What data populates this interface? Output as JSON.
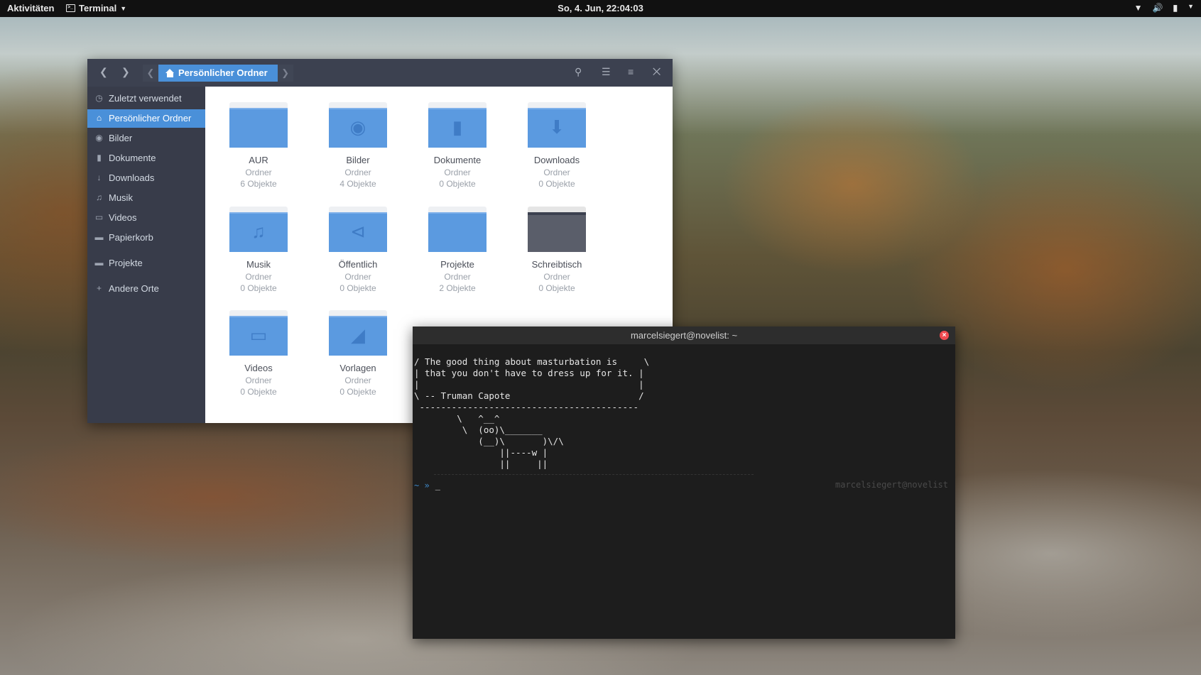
{
  "topbar": {
    "activities": "Aktivitäten",
    "app_name": "Terminal",
    "clock": "So,  4. Jun, 22:04:03"
  },
  "file_manager": {
    "path_current": "Persönlicher Ordner",
    "sidebar": [
      {
        "label": "Zuletzt verwendet",
        "icon": "clock-icon"
      },
      {
        "label": "Persönlicher Ordner",
        "icon": "home-icon",
        "active": true
      },
      {
        "label": "Bilder",
        "icon": "camera-icon"
      },
      {
        "label": "Dokumente",
        "icon": "document-icon"
      },
      {
        "label": "Downloads",
        "icon": "download-icon"
      },
      {
        "label": "Musik",
        "icon": "music-icon"
      },
      {
        "label": "Videos",
        "icon": "film-icon"
      },
      {
        "label": "Papierkorb",
        "icon": "trash-icon"
      },
      {
        "label": "Projekte",
        "icon": "folder-icon"
      },
      {
        "label": "Andere Orte",
        "icon": "plus-icon"
      }
    ],
    "folders": [
      {
        "name": "AUR",
        "type": "Ordner",
        "count": "6 Objekte",
        "icon": "folder-icon"
      },
      {
        "name": "Bilder",
        "type": "Ordner",
        "count": "4 Objekte",
        "icon": "camera-icon"
      },
      {
        "name": "Dokumente",
        "type": "Ordner",
        "count": "0 Objekte",
        "icon": "document-icon"
      },
      {
        "name": "Downloads",
        "type": "Ordner",
        "count": "0 Objekte",
        "icon": "download-icon"
      },
      {
        "name": "Musik",
        "type": "Ordner",
        "count": "0 Objekte",
        "icon": "music-icon"
      },
      {
        "name": "Öffentlich",
        "type": "Ordner",
        "count": "0 Objekte",
        "icon": "share-icon"
      },
      {
        "name": "Projekte",
        "type": "Ordner",
        "count": "2 Objekte",
        "icon": "folder-icon"
      },
      {
        "name": "Schreibtisch",
        "type": "Ordner",
        "count": "0 Objekte",
        "icon": "desktop-icon"
      },
      {
        "name": "Videos",
        "type": "Ordner",
        "count": "0 Objekte",
        "icon": "film-icon"
      },
      {
        "name": "Vorlagen",
        "type": "Ordner",
        "count": "0 Objekte",
        "icon": "template-icon"
      }
    ],
    "accent_color": "#4a90d9"
  },
  "terminal": {
    "title": "marcelsiegert@novelist: ~",
    "output": "/ The good thing about masturbation is     \\\n| that you don't have to dress up for it. |\n|                                         |\n\\ -- Truman Capote                        /\n -----------------------------------------\n        \\   ^__^\n         \\  (oo)\\_______\n            (__)\\       )\\/\\\n                ||----w |\n                ||     ||",
    "prompt": "~ »",
    "cursor": "_",
    "right_prompt": "marcelsiegert@novelist"
  }
}
